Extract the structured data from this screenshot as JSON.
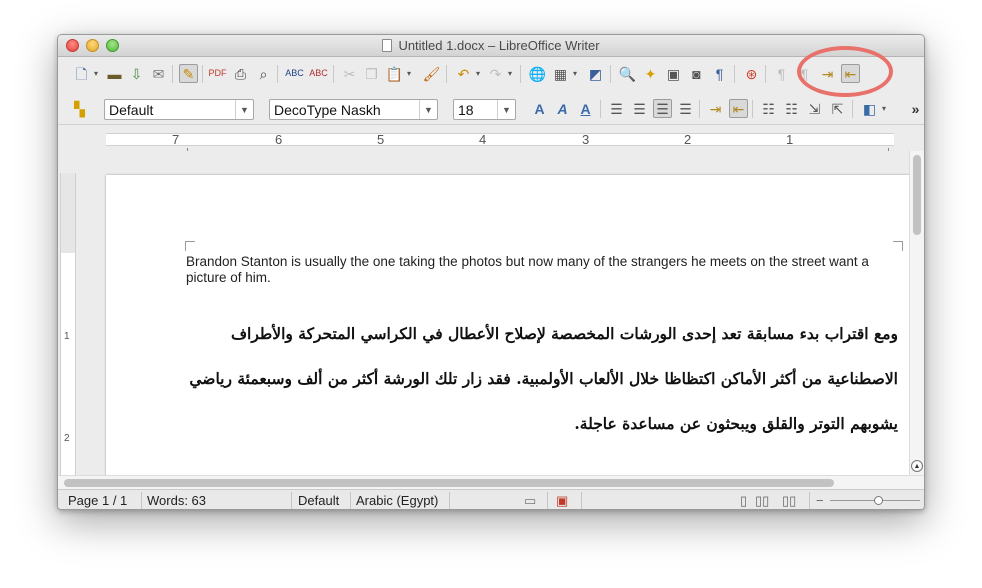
{
  "window": {
    "title": "Untitled 1.docx – LibreOffice Writer"
  },
  "toolbar": {
    "paragraph_style": "Default",
    "font_name": "DecoType Naskh",
    "font_size": "18",
    "overflow": "»"
  },
  "ruler": {
    "labels": [
      "7",
      "6",
      "5",
      "4",
      "3",
      "2",
      "1"
    ],
    "vertical_labels": [
      "1",
      "2"
    ]
  },
  "document": {
    "english_paragraph": "Brandon Stanton is usually the one taking the photos but now many of the strangers he meets on the street want a picture of him.",
    "arabic_paragraph": "ومع اقتراب بدء مسابقة تعد إحدى الورشات المخصصة لإصلاح الأعطال في الكراسي المتحركة والأطراف الاصطناعية من أكثر الأماكن اكتظاظا خلال الألعاب الأولمبية. فقد زار تلك الورشة أكثر من ألف وسبعمئة رياضي يشوبهم التوتر والقلق ويبحثون عن مساعدة عاجلة."
  },
  "status": {
    "page": "Page 1 / 1",
    "words": "Words: 63",
    "page_style": "Default",
    "language": "Arabic (Egypt)"
  },
  "colors": {
    "highlight_circle": "#e8716a",
    "icon_blue": "#3a5f9a"
  }
}
